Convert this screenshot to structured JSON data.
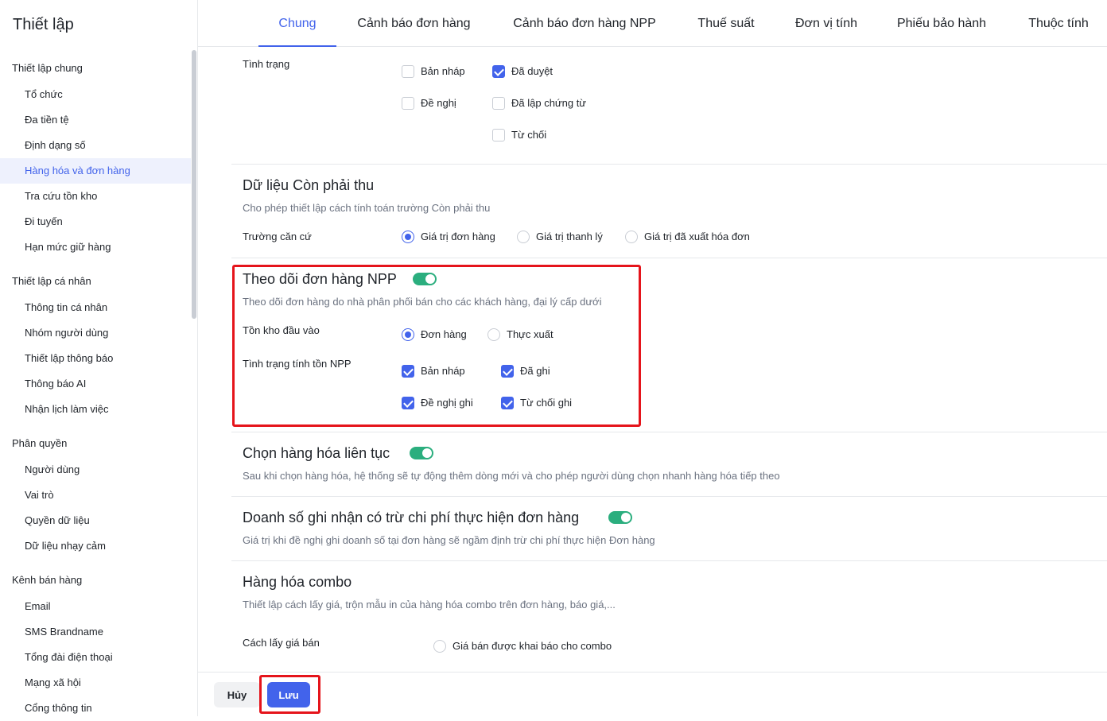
{
  "sidebar": {
    "title": "Thiết lập",
    "groups": [
      {
        "label": "Thiết lập chung",
        "items": [
          "Tổ chức",
          "Đa tiền tệ",
          "Định dạng số",
          "Hàng hóa và đơn hàng",
          "Tra cứu tồn kho",
          "Đi tuyến",
          "Hạn mức giữ hàng"
        ]
      },
      {
        "label": "Thiết lập cá nhân",
        "items": [
          "Thông tin cá nhân",
          "Nhóm người dùng",
          "Thiết lập thông báo",
          "Thông báo AI",
          "Nhận lịch làm việc"
        ]
      },
      {
        "label": "Phân quyền",
        "items": [
          "Người dùng",
          "Vai trò",
          "Quyền dữ liệu",
          "Dữ liệu nhạy cảm"
        ]
      },
      {
        "label": "Kênh bán hàng",
        "items": [
          "Email",
          "SMS Brandname",
          "Tổng đài điện thoại",
          "Mạng xã hội",
          "Cổng thông tin"
        ]
      }
    ],
    "active_item": "Hàng hóa và đơn hàng"
  },
  "tabs": [
    "Chung",
    "Cảnh báo đơn hàng",
    "Cảnh báo đơn hàng NPP",
    "Thuế suất",
    "Đơn vị tính",
    "Phiếu bảo hành",
    "Thuộc tính"
  ],
  "status_section": {
    "label": "Tình trạng",
    "options": [
      {
        "label": "Bản nháp",
        "checked": false
      },
      {
        "label": "Đã duyệt",
        "checked": true
      },
      {
        "label": "Đề nghị",
        "checked": false
      },
      {
        "label": "Đã lập chứng từ",
        "checked": false
      },
      {
        "label": "Từ chối",
        "checked": false
      }
    ]
  },
  "receivable": {
    "title": "Dữ liệu Còn phải thu",
    "desc": "Cho phép thiết lập cách tính toán trường Còn phải thu",
    "field_label": "Trường căn cứ",
    "options": [
      {
        "label": "Giá trị đơn hàng",
        "selected": true
      },
      {
        "label": "Giá trị thanh lý",
        "selected": false
      },
      {
        "label": "Giá trị đã xuất hóa đơn",
        "selected": false
      }
    ]
  },
  "npp_tracking": {
    "title": "Theo dõi đơn hàng NPP",
    "enabled": true,
    "desc": "Theo dõi đơn hàng do nhà phân phối bán cho các khách hàng, đại lý cấp dưới",
    "stock_label": "Tồn kho đầu vào",
    "stock_options": [
      {
        "label": "Đơn hàng",
        "selected": true
      },
      {
        "label": "Thực xuất",
        "selected": false
      }
    ],
    "status_label": "Tình trạng tính tồn NPP",
    "status_options": [
      {
        "label": "Bản nháp",
        "checked": true
      },
      {
        "label": "Đã ghi",
        "checked": true
      },
      {
        "label": "Đề nghị ghi",
        "checked": true
      },
      {
        "label": "Từ chối ghi",
        "checked": true
      }
    ]
  },
  "continuous_pick": {
    "title": "Chọn hàng hóa liên tục",
    "enabled": true,
    "desc": "Sau khi chọn hàng hóa, hệ thống sẽ tự động thêm dòng mới và cho phép người dùng chọn nhanh hàng hóa tiếp theo"
  },
  "revenue_cost": {
    "title": "Doanh số ghi nhận có trừ chi phí thực hiện đơn hàng",
    "enabled": true,
    "desc": "Giá trị khi đề nghị ghi doanh số tại đơn hàng sẽ ngầm định trừ chi phí thực hiện Đơn hàng"
  },
  "combo": {
    "title": "Hàng hóa combo",
    "desc": "Thiết lập cách lấy giá, trộn mẫu in của hàng hóa combo trên đơn hàng, báo giá,...",
    "price_label": "Cách lấy giá bán",
    "price_option": "Giá bán được khai báo cho combo"
  },
  "footer": {
    "cancel_label": "Hủy",
    "save_label": "Lưu"
  },
  "colors": {
    "accent": "#4263eb",
    "toggle_on": "#2bae7e",
    "highlight": "#e5141b"
  }
}
